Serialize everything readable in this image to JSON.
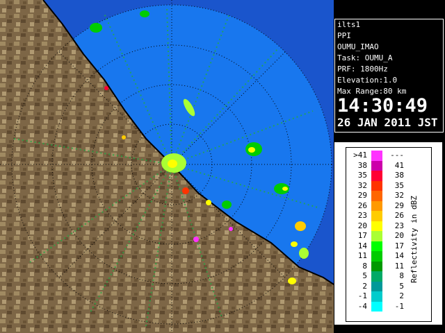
{
  "header": {
    "site": "ilts1",
    "product": "PPI",
    "radar_id": "OUMU_IMAO",
    "task": "Task: OUMU_A",
    "prf": "PRF: 1800Hz",
    "elevation": "Elevation:1.0",
    "max_range": "Max Range:80 km",
    "time": "14:30:49",
    "date": "26 JAN 2011 JST"
  },
  "legend": {
    "title": "Reflectivity in dBZ",
    "rows": [
      {
        "lo": ">41",
        "hi": "---",
        "color": "#ff33ff"
      },
      {
        "lo": "38",
        "hi": "41",
        "color": "#cc00aa"
      },
      {
        "lo": "35",
        "hi": "38",
        "color": "#ff0033"
      },
      {
        "lo": "32",
        "hi": "35",
        "color": "#ff3300"
      },
      {
        "lo": "29",
        "hi": "32",
        "color": "#ff6600"
      },
      {
        "lo": "26",
        "hi": "29",
        "color": "#ff9900"
      },
      {
        "lo": "23",
        "hi": "26",
        "color": "#ffcc00"
      },
      {
        "lo": "20",
        "hi": "23",
        "color": "#ffff00"
      },
      {
        "lo": "17",
        "hi": "20",
        "color": "#aaff33"
      },
      {
        "lo": "14",
        "hi": "17",
        "color": "#00ff00"
      },
      {
        "lo": "11",
        "hi": "14",
        "color": "#00cc00"
      },
      {
        "lo": "8",
        "hi": "11",
        "color": "#009900"
      },
      {
        "lo": "5",
        "hi": "8",
        "color": "#00aa66"
      },
      {
        "lo": "2",
        "hi": "5",
        "color": "#009999"
      },
      {
        "lo": "-1",
        "hi": "2",
        "color": "#00cccc"
      },
      {
        "lo": "-4",
        "hi": "-1",
        "color": "#00ffff"
      }
    ]
  },
  "colors": {
    "sea_coverage": "#1877ee",
    "sea_outside": "#1a55cc",
    "land": "#8a6e4a",
    "coast": "#000000",
    "range_rings": "#000000"
  }
}
